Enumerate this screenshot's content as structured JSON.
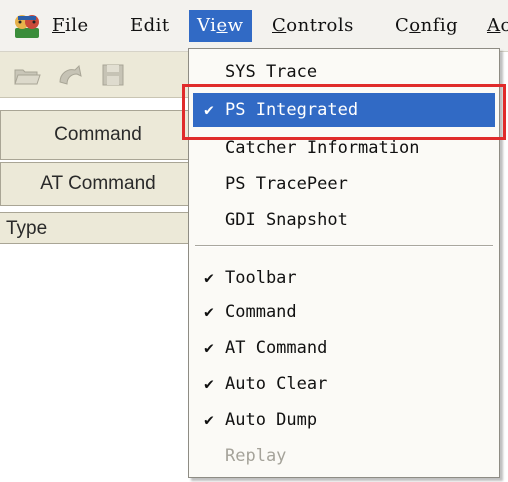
{
  "menubar": {
    "items": [
      {
        "accel": "F",
        "rest": "ile"
      },
      {
        "accel": "",
        "rest": "Edit"
      },
      {
        "accel": "",
        "pre": "Vi",
        "accel2": "e",
        "rest": "w"
      },
      {
        "accel": "C",
        "rest": "ontrols"
      },
      {
        "accel": "",
        "pre": "C",
        "accel2": "o",
        "rest": "nfig"
      },
      {
        "accel": "A",
        "rest": "c"
      }
    ]
  },
  "panes": {
    "command_label": "Command",
    "at_command_label": "AT Command",
    "type_header": "Type"
  },
  "view_menu": {
    "items": [
      {
        "label": "SYS Trace",
        "checked": false,
        "highlighted": false,
        "disabled": false
      },
      {
        "label": "PS Integrated",
        "checked": true,
        "highlighted": true,
        "disabled": false
      },
      {
        "label": "Catcher Information",
        "checked": false,
        "highlighted": false,
        "disabled": false
      },
      {
        "label": "PS TracePeer",
        "checked": false,
        "highlighted": false,
        "disabled": false
      },
      {
        "label": "GDI Snapshot",
        "checked": false,
        "highlighted": false,
        "disabled": false
      },
      {
        "label": "Toolbar",
        "checked": true,
        "highlighted": false,
        "disabled": false
      },
      {
        "label": "Command",
        "checked": true,
        "highlighted": false,
        "disabled": false
      },
      {
        "label": "AT Command",
        "checked": true,
        "highlighted": false,
        "disabled": false
      },
      {
        "label": "Auto Clear",
        "checked": true,
        "highlighted": false,
        "disabled": false
      },
      {
        "label": "Auto Dump",
        "checked": true,
        "highlighted": false,
        "disabled": false
      },
      {
        "label": "Replay",
        "checked": false,
        "highlighted": false,
        "disabled": true
      }
    ]
  },
  "colors": {
    "highlight": "#316ac5",
    "annotation_box": "#e02b2b",
    "menu_bg": "#fbfaf6",
    "disabled_text": "#a5a39a"
  }
}
